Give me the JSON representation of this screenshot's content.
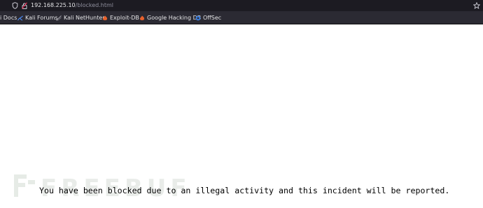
{
  "browser": {
    "url_host": "192.168.225.10",
    "url_path": "/blocked.html"
  },
  "bookmarks": [
    {
      "label": "i Docs",
      "icon": "kali-docs-icon"
    },
    {
      "label": "Kali Forums",
      "icon": "kali-dragon-icon"
    },
    {
      "label": "Kali NetHunter",
      "icon": "nethunter-icon"
    },
    {
      "label": "Exploit-DB",
      "icon": "exploit-db-icon"
    },
    {
      "label": "Google Hacking DB",
      "icon": "ghdb-icon"
    },
    {
      "label": "OffSec",
      "icon": "offsec-icon"
    }
  ],
  "page": {
    "message": "You have been blocked due to an illegal activity and this incident will be reported."
  },
  "watermark": {
    "text": "FREEBUF"
  },
  "colors": {
    "toolbar_bg": "#1c1b22",
    "bookmarks_bg": "#2b2a33",
    "exploit_orange": "#e8612c",
    "offsec_blue": "#3b7ddd",
    "kali_blue": "#4c8bf5"
  }
}
